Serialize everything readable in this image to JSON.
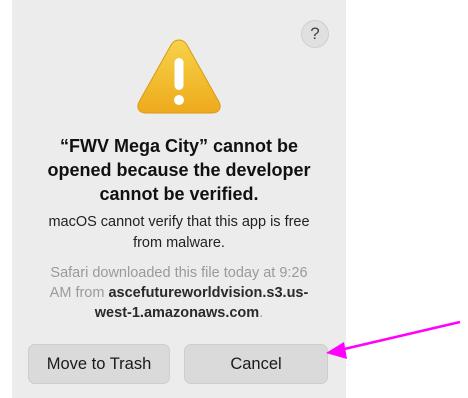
{
  "dialog": {
    "help_glyph": "?",
    "icon": "warning-triangle-icon",
    "title_line1": "“FWV Mega City” cannot be",
    "title_line2": "opened because the developer",
    "title_line3": "cannot be verified.",
    "message_line1": "macOS cannot verify that this app is free",
    "message_line2": "from malware.",
    "source_line1": "Safari downloaded this file today at 9:26",
    "source_line2_prefix": "AM from ",
    "source_domain_part1": "ascefutureworldvision.s3.us-",
    "source_domain_part2": "west-1.amazonaws.com",
    "source_line3_suffix": ".",
    "buttons": {
      "move_to_trash": "Move to Trash",
      "cancel": "Cancel"
    }
  },
  "annotation": {
    "arrow_color": "#ff00ff"
  },
  "colors": {
    "dialog_bg": "#ececec",
    "icon_fill": "#f2bd2a",
    "button_bg": "#dadada"
  }
}
